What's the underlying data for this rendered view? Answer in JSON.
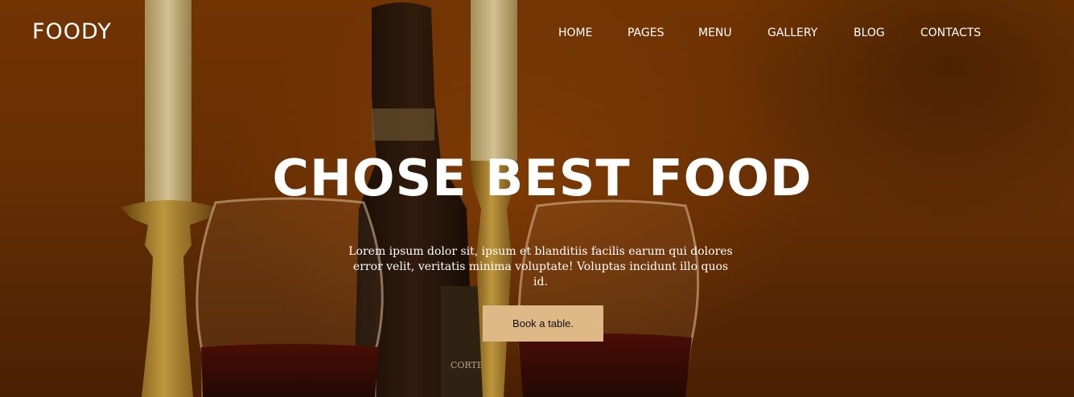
{
  "brand": {
    "name": "FOODY"
  },
  "nav": {
    "items": [
      {
        "label": "HOME"
      },
      {
        "label": "PAGES"
      },
      {
        "label": "MENU"
      },
      {
        "label": "GALLERY"
      },
      {
        "label": "BLOG"
      },
      {
        "label": "CONTACTS"
      }
    ]
  },
  "hero": {
    "title": "CHOSE BEST FOOD",
    "lead": "Lorem ipsum dolor sit, ipsum et blanditiis facilis earum qui dolores error velit, veritatis minima voluptate! Voluptas incidunt illo quos id.",
    "button_label": "Book a table.",
    "label_text": "CORTE",
    "colors": {
      "accent": "#deb887",
      "text": "#ffffff",
      "background": "#6c3305"
    }
  }
}
